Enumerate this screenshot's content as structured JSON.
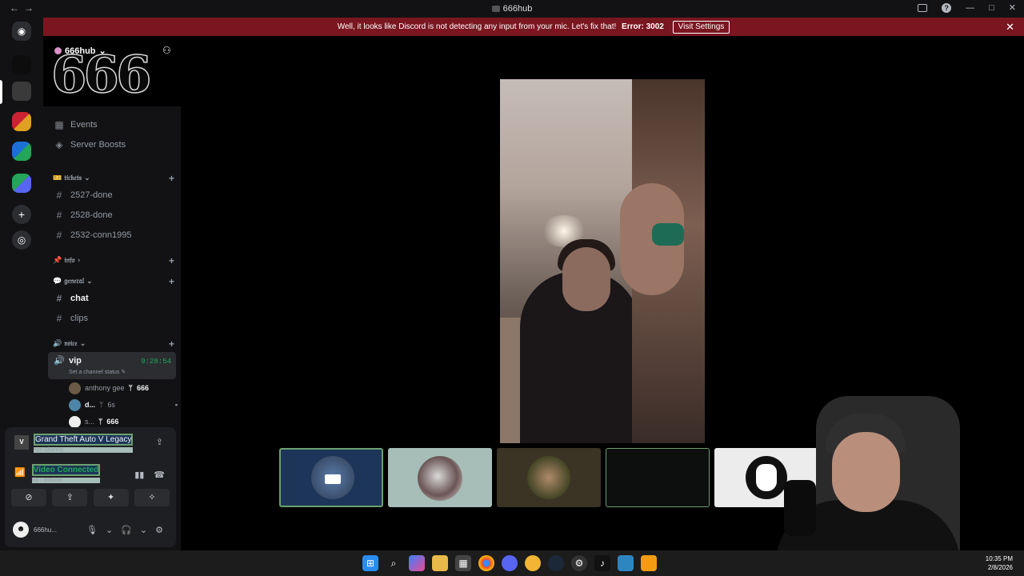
{
  "window": {
    "title": "666hub",
    "nav_back": "←",
    "nav_forward": "→",
    "help_glyph": "?",
    "inbox_glyph": "▭",
    "min_glyph": "—",
    "max_glyph": "□",
    "close_glyph": "✕"
  },
  "banner": {
    "message": "Well, it looks like Discord is not detecting any input from your mic. Let's fix that!",
    "error": "Error: 3002",
    "button": "Visit Settings",
    "close_glyph": "✕"
  },
  "server": {
    "name": "666hub",
    "banner_art": "666",
    "chevron": "⌄",
    "invite_glyph": "⚇"
  },
  "sidebar": {
    "events": "Events",
    "events_icon": "calendar-icon",
    "boosts": "Server Boosts",
    "boosts_icon": "boost-icon",
    "categories": [
      {
        "label": "🎫 𝔱𝔦𝔠𝔨𝔢𝔱𝔰",
        "channels": [
          "2527-done",
          "2528-done",
          "2532-conn1995"
        ]
      },
      {
        "label": "📌 𝔦𝔫𝔣𝔬",
        "channels": []
      },
      {
        "label": "💬 𝔤𝔢𝔫𝔢𝔯𝔞𝔩",
        "channels": [
          "chat",
          "clips"
        ]
      },
      {
        "label": "🔊 𝔳𝔬𝔦𝔠𝔢",
        "channels": []
      }
    ],
    "hash": "#",
    "add": "+",
    "voice_channel": {
      "name": "vip",
      "time": "9:28:54",
      "status": "Set a channel status ✎",
      "members": [
        {
          "name": "anthony gee",
          "tag": "666",
          "tag_glyph": "ᛘ"
        },
        {
          "name": "d...",
          "tag": "6s",
          "tag_glyph": "ᛘ"
        },
        {
          "name": "s...",
          "tag": "666",
          "tag_glyph": "ᛘ"
        }
      ]
    }
  },
  "panel": {
    "game_title": "Grand Theft Auto V Legacy",
    "game_status": "Not Sharing",
    "game_icon_text": "V",
    "connection": "Video Connected",
    "connection_sub": "vip / 666hub",
    "user_name": "666hu...",
    "glyphs": {
      "share": "⇪",
      "signal": "📶",
      "wave": "▮▮",
      "hangup": "☎",
      "cam_off": "⊘",
      "screen": "⇪",
      "activity": "✦",
      "soundboard": "✧",
      "mic": "🎙",
      "caret": "⌄",
      "headset": "🎧",
      "settings": "⚙"
    }
  },
  "taskbar": {
    "time": "10:35 PM",
    "date": "2/8/2026",
    "icons": [
      "windows-start-icon",
      "search-icon",
      "copilot-icon",
      "file-explorer-icon",
      "store-icon",
      "chrome-icon",
      "discord-icon",
      "app-icon",
      "steam-icon",
      "settings-icon",
      "tiktok-icon",
      "app-icon-2",
      "app-icon-3"
    ]
  }
}
